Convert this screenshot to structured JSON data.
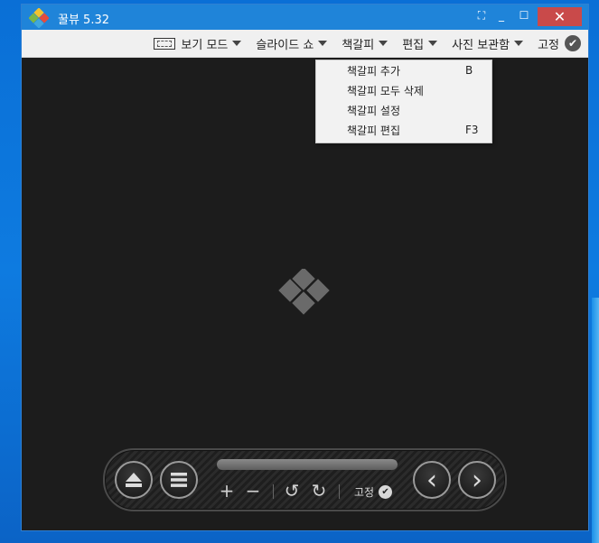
{
  "window": {
    "title": "꿀뷰 5.32",
    "close_glyph": "✕",
    "min_glyph": "_",
    "max_glyph": "☐",
    "restore_glyph": "⛶"
  },
  "menubar": {
    "items": [
      {
        "label": "보기 모드",
        "icon": "view-mode-icon"
      },
      {
        "label": "슬라이드 쇼"
      },
      {
        "label": "책갈피"
      },
      {
        "label": "편집"
      },
      {
        "label": "사진 보관함"
      }
    ],
    "pin_label": "고정",
    "pin_glyph": "✔"
  },
  "dropdown": {
    "items": [
      {
        "label": "책갈피 추가",
        "shortcut": "B"
      },
      {
        "label": "책갈피 모두 삭제",
        "shortcut": ""
      },
      {
        "label": "책갈피 설정",
        "shortcut": ""
      },
      {
        "label": "책갈피 편집",
        "shortcut": "F3"
      }
    ]
  },
  "controls": {
    "zoom_in": "+",
    "zoom_out": "−",
    "rotate_left": "↺",
    "rotate_right": "↻",
    "pin_label": "고정",
    "pin_glyph": "✔",
    "prev_glyph": "‹",
    "next_glyph": "›"
  },
  "colors": {
    "titlebar": "#1f84d9",
    "close": "#c94a4a",
    "viewer_bg": "#1c1c1c"
  }
}
